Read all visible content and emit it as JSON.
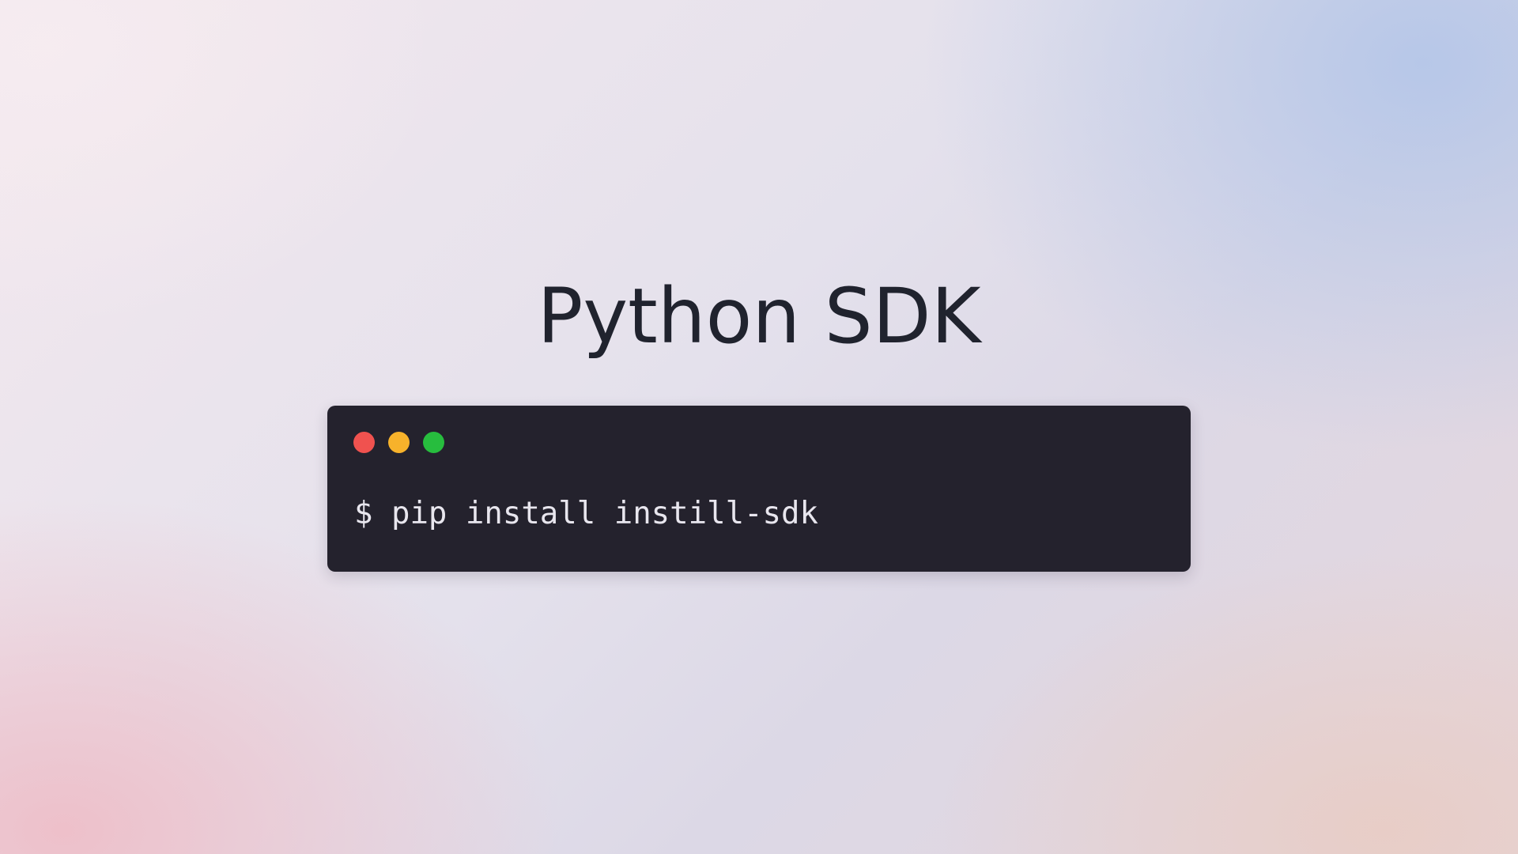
{
  "page": {
    "title": "Python SDK"
  },
  "terminal": {
    "window_controls": [
      {
        "name": "close",
        "color": "#f0524f"
      },
      {
        "name": "minimize",
        "color": "#f7b22b"
      },
      {
        "name": "maximize",
        "color": "#27bd3e"
      }
    ],
    "background_color": "#24222d",
    "command": "$ pip install instill-sdk"
  }
}
